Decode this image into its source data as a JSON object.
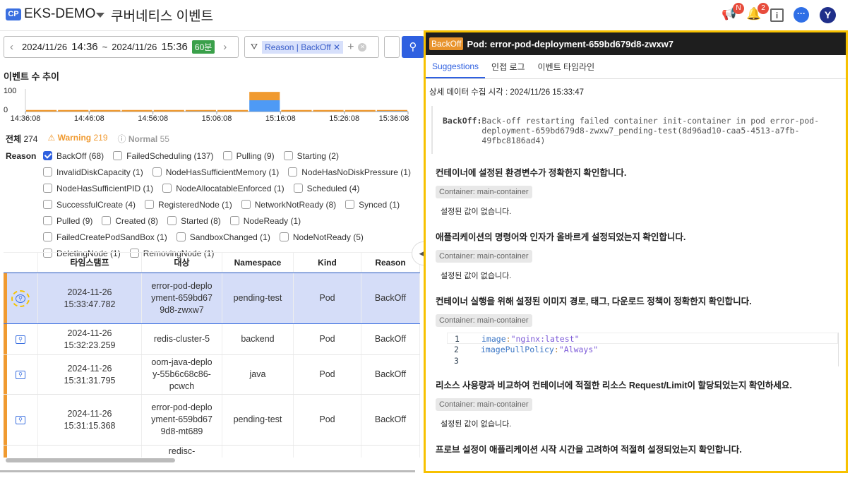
{
  "header": {
    "badge": "CP",
    "project": "EKS-DEMO",
    "title": "쿠버네티스 이벤트",
    "notice_badge": "N",
    "alarm_badge": "2",
    "avatar": "Y",
    "icons": [
      "megaphone-icon",
      "bell-icon",
      "info-book-icon",
      "chat-icon",
      "avatar"
    ]
  },
  "toolbar": {
    "date_from": "2024/11/26",
    "time_from": "14:36",
    "sep": "~",
    "date_to": "2024/11/26",
    "time_to": "15:36",
    "range": "60분",
    "filter_chip": "Reason | BackOff"
  },
  "chart": {
    "title": "이벤트 수 추이"
  },
  "chart_data": {
    "type": "bar",
    "stacked": true,
    "ylim": [
      0,
      100
    ],
    "yticks": [
      "100",
      "0"
    ],
    "xticks": [
      "14:36:08",
      "14:46:08",
      "14:56:08",
      "15:06:08",
      "15:16:08",
      "15:26:08",
      "15:36:08"
    ],
    "series": [
      {
        "name": "Normal",
        "color": "#4e9af5",
        "values": [
          0,
          0,
          0,
          0,
          0,
          1,
          0,
          50,
          0,
          0,
          0,
          2
        ]
      },
      {
        "name": "Warning",
        "color": "#f09a30",
        "values": [
          7,
          7,
          7,
          7,
          7,
          6,
          7,
          37,
          7,
          7,
          7,
          5
        ]
      }
    ]
  },
  "summary": {
    "total_label": "전체",
    "total": "274",
    "warning_label": "Warning",
    "warning": "219",
    "normal_label": "Normal",
    "normal": "55"
  },
  "reason_label": "Reason",
  "reasons": [
    {
      "label": "BackOff (68)",
      "checked": true
    },
    {
      "label": "FailedScheduling (137)"
    },
    {
      "label": "Pulling (9)"
    },
    {
      "label": "Starting (2)"
    },
    {
      "label": "InvalidDiskCapacity (1)"
    },
    {
      "label": "NodeHasSufficientMemory (1)"
    },
    {
      "label": "NodeHasNoDiskPressure (1)"
    },
    {
      "label": "NodeHasSufficientPID (1)"
    },
    {
      "label": "NodeAllocatableEnforced (1)"
    },
    {
      "label": "Scheduled (4)"
    },
    {
      "label": "SuccessfulCreate (4)"
    },
    {
      "label": "RegisteredNode (1)"
    },
    {
      "label": "NetworkNotReady (8)"
    },
    {
      "label": "Synced (1)"
    },
    {
      "label": "Pulled (9)"
    },
    {
      "label": "Created (8)"
    },
    {
      "label": "Started (8)"
    },
    {
      "label": "NodeReady (1)"
    },
    {
      "label": "FailedCreatePodSandBox (1)"
    },
    {
      "label": "SandboxChanged (1)"
    },
    {
      "label": "NodeNotReady (5)"
    },
    {
      "label": "DeletingNode (1)"
    },
    {
      "label": "RemovingNode (1)"
    }
  ],
  "table": {
    "columns": [
      "",
      "타임스탬프",
      "대상",
      "Namespace",
      "Kind",
      "Reason"
    ],
    "rows": [
      {
        "ts": "2024-11-26 15:33:47.782",
        "target": "error-pod-deployment-659bd679d8-zwxw7",
        "ns": "pending-test",
        "kind": "Pod",
        "reason": "BackOff",
        "selected": true
      },
      {
        "ts": "2024-11-26 15:32:23.259",
        "target": "redis-cluster-5",
        "ns": "backend",
        "kind": "Pod",
        "reason": "BackOff"
      },
      {
        "ts": "2024-11-26 15:31:31.795",
        "target": "oom-java-deploy-55b6c68c86-pcwch",
        "ns": "java",
        "kind": "Pod",
        "reason": "BackOff"
      },
      {
        "ts": "2024-11-26 15:31:15.368",
        "target": "error-pod-deployment-659bd679d8-mt689",
        "ns": "pending-test",
        "kind": "Pod",
        "reason": "BackOff"
      },
      {
        "ts": "",
        "target": "redisc-",
        "ns": "",
        "kind": "",
        "reason": ""
      }
    ]
  },
  "panel": {
    "badge": "BackOff",
    "title": "Pod: error-pod-deployment-659bd679d8-zwxw7",
    "tabs": [
      "Suggestions",
      "인접 로그",
      "이벤트 타임라인"
    ],
    "collected": "상세 데이터 수집 시각 : 2024/11/26 15:33:47",
    "msg_key": "BackOff:",
    "msg": "Back-off restarting failed container init-container in pod error-pod-deployment-659bd679d8-zwxw7_pending-test(8d96ad10-caa5-4513-a7fb-49fbc8186ad4)",
    "suggestions": [
      {
        "title": "컨테이너에 설정된 환경변수가 정확한지 확인합니다.",
        "container": "Container: main-container",
        "text": "설정된 값이 없습니다."
      },
      {
        "title": "애플리케이션의 명령어와 인자가 올바르게 설정되었는지 확인합니다.",
        "container": "Container: main-container",
        "text": "설정된 값이 없습니다."
      },
      {
        "title": "컨테이너 실행을 위해 설정된 이미지 경로, 태그, 다운로드 정책이 정확한지 확인합니다.",
        "container": "Container: main-container",
        "code": [
          {
            "n": "1",
            "k": "image",
            "v": "\"nginx:latest\""
          },
          {
            "n": "2",
            "k": "imagePullPolicy",
            "v": "\"Always\""
          },
          {
            "n": "3",
            "k": "",
            "v": ""
          }
        ]
      },
      {
        "title": "리소스 사용량과 비교하여 컨테이너에 적절한 리소스 Request/Limit이 할당되었는지 확인하세요.",
        "container": "Container: main-container",
        "text": "설정된 값이 없습니다."
      },
      {
        "title": "프로브 설정이 애플리케이션 시작 시간을 고려하여 적절히 설정되었는지 확인합니다."
      }
    ]
  }
}
